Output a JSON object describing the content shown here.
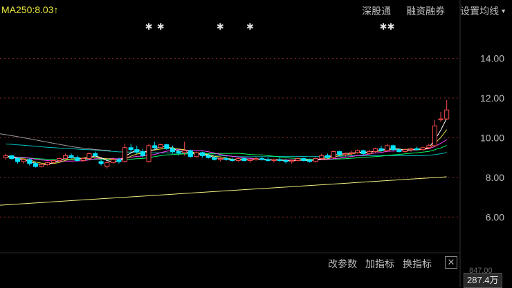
{
  "header": {
    "ma_label": "MA250:8.03",
    "arrow": "↑",
    "menu": [
      "深股通",
      "融资融券",
      "设置均线"
    ]
  },
  "footer": {
    "tools": [
      "改参数",
      "加指标",
      "换指标"
    ],
    "volume": "287.4万",
    "clipped_value": "847.00"
  },
  "colors": {
    "up": "#ff4d4d",
    "down": "#00e5ff",
    "ma5": "#ffffff",
    "ma10": "#e8e840",
    "ma20": "#ff40ff",
    "ma60": "#00ff66",
    "ma120": "#00c0c0",
    "ma250": "#f0f080"
  },
  "chart_data": {
    "type": "candlestick",
    "y_ticks": [
      "14.00",
      "12.00",
      "10.00",
      "8.00",
      "6.00"
    ],
    "ylim": [
      4.2,
      15.9
    ],
    "grid": true,
    "events": [
      {
        "symbol": "✱",
        "index": 24
      },
      {
        "symbol": "✱",
        "index": 26
      },
      {
        "symbol": "✱",
        "index": 36
      },
      {
        "symbol": "✱",
        "index": 41
      },
      {
        "symbol": "✱✱",
        "index": 64
      }
    ],
    "candles": [
      [
        9.0,
        9.2,
        8.9,
        9.1
      ],
      [
        9.1,
        9.1,
        8.9,
        8.95
      ],
      [
        8.95,
        9.0,
        8.7,
        8.8
      ],
      [
        8.8,
        8.95,
        8.7,
        8.9
      ],
      [
        8.9,
        8.95,
        8.6,
        8.7
      ],
      [
        8.7,
        8.8,
        8.5,
        8.55
      ],
      [
        8.55,
        8.7,
        8.5,
        8.65
      ],
      [
        8.65,
        8.8,
        8.6,
        8.75
      ],
      [
        8.75,
        8.9,
        8.7,
        8.85
      ],
      [
        8.85,
        9.0,
        8.8,
        8.95
      ],
      [
        8.95,
        9.2,
        8.9,
        9.1
      ],
      [
        9.1,
        9.2,
        8.95,
        9.0
      ],
      [
        9.0,
        9.1,
        8.8,
        8.85
      ],
      [
        8.85,
        9.0,
        8.8,
        8.95
      ],
      [
        8.95,
        9.25,
        8.9,
        9.2
      ],
      [
        9.2,
        9.3,
        9.0,
        9.1
      ],
      [
        8.8,
        8.9,
        8.6,
        8.7
      ],
      [
        8.55,
        8.8,
        8.45,
        8.75
      ],
      [
        8.75,
        9.0,
        8.7,
        8.9
      ],
      [
        8.9,
        9.0,
        8.7,
        8.8
      ],
      [
        8.8,
        9.7,
        8.75,
        9.5
      ],
      [
        9.5,
        9.7,
        9.3,
        9.4
      ],
      [
        9.4,
        9.6,
        9.2,
        9.3
      ],
      [
        9.3,
        9.45,
        9.0,
        9.1
      ],
      [
        8.8,
        9.7,
        8.75,
        9.6
      ],
      [
        9.6,
        9.8,
        9.4,
        9.5
      ],
      [
        9.5,
        9.7,
        9.5,
        9.65
      ],
      [
        9.65,
        9.7,
        9.4,
        9.45
      ],
      [
        9.45,
        9.6,
        9.2,
        9.3
      ],
      [
        9.3,
        9.4,
        9.1,
        9.25
      ],
      [
        9.25,
        9.8,
        9.1,
        9.35
      ],
      [
        9.35,
        9.4,
        9.0,
        9.05
      ],
      [
        9.05,
        9.3,
        9.0,
        9.25
      ],
      [
        9.25,
        9.3,
        9.0,
        9.1
      ],
      [
        9.1,
        9.2,
        8.95,
        9.0
      ],
      [
        9.0,
        9.05,
        8.85,
        8.9
      ],
      [
        8.9,
        9.0,
        8.8,
        8.95
      ],
      [
        8.95,
        9.05,
        8.85,
        8.9
      ],
      [
        8.9,
        9.0,
        8.8,
        8.85
      ],
      [
        8.85,
        9.0,
        8.8,
        8.95
      ],
      [
        8.95,
        9.0,
        8.8,
        8.85
      ],
      [
        8.85,
        8.95,
        8.75,
        8.9
      ],
      [
        8.9,
        9.0,
        8.85,
        8.95
      ],
      [
        8.95,
        9.05,
        8.85,
        8.9
      ],
      [
        8.9,
        9.0,
        8.8,
        8.85
      ],
      [
        8.85,
        8.95,
        8.75,
        8.9
      ],
      [
        8.9,
        9.0,
        8.8,
        8.85
      ],
      [
        8.85,
        8.95,
        8.7,
        8.8
      ],
      [
        8.8,
        8.9,
        8.7,
        8.85
      ],
      [
        8.85,
        9.0,
        8.8,
        8.95
      ],
      [
        8.95,
        9.0,
        8.8,
        8.85
      ],
      [
        8.85,
        8.95,
        8.75,
        8.8
      ],
      [
        8.8,
        9.0,
        8.75,
        8.95
      ],
      [
        8.95,
        9.2,
        8.9,
        9.1
      ],
      [
        9.1,
        9.2,
        8.95,
        9.0
      ],
      [
        9.0,
        9.35,
        8.95,
        9.3
      ],
      [
        9.3,
        9.35,
        9.1,
        9.15
      ],
      [
        9.15,
        9.25,
        9.05,
        9.2
      ],
      [
        9.2,
        9.35,
        9.1,
        9.25
      ],
      [
        9.25,
        9.4,
        9.2,
        9.35
      ],
      [
        9.35,
        9.4,
        9.15,
        9.2
      ],
      [
        9.2,
        9.4,
        9.15,
        9.3
      ],
      [
        9.3,
        9.5,
        9.25,
        9.45
      ],
      [
        9.45,
        9.6,
        9.3,
        9.35
      ],
      [
        9.35,
        9.7,
        9.3,
        9.6
      ],
      [
        9.6,
        9.65,
        9.35,
        9.4
      ],
      [
        9.4,
        9.45,
        9.25,
        9.3
      ],
      [
        9.3,
        9.45,
        9.25,
        9.4
      ],
      [
        9.4,
        9.5,
        9.3,
        9.45
      ],
      [
        9.45,
        9.55,
        9.35,
        9.4
      ],
      [
        9.4,
        9.55,
        9.35,
        9.5
      ],
      [
        9.5,
        9.7,
        9.45,
        9.6
      ],
      [
        9.6,
        10.9,
        9.55,
        10.6
      ],
      [
        10.9,
        11.3,
        10.8,
        10.95
      ],
      [
        10.95,
        11.9,
        10.9,
        11.4
      ]
    ]
  }
}
